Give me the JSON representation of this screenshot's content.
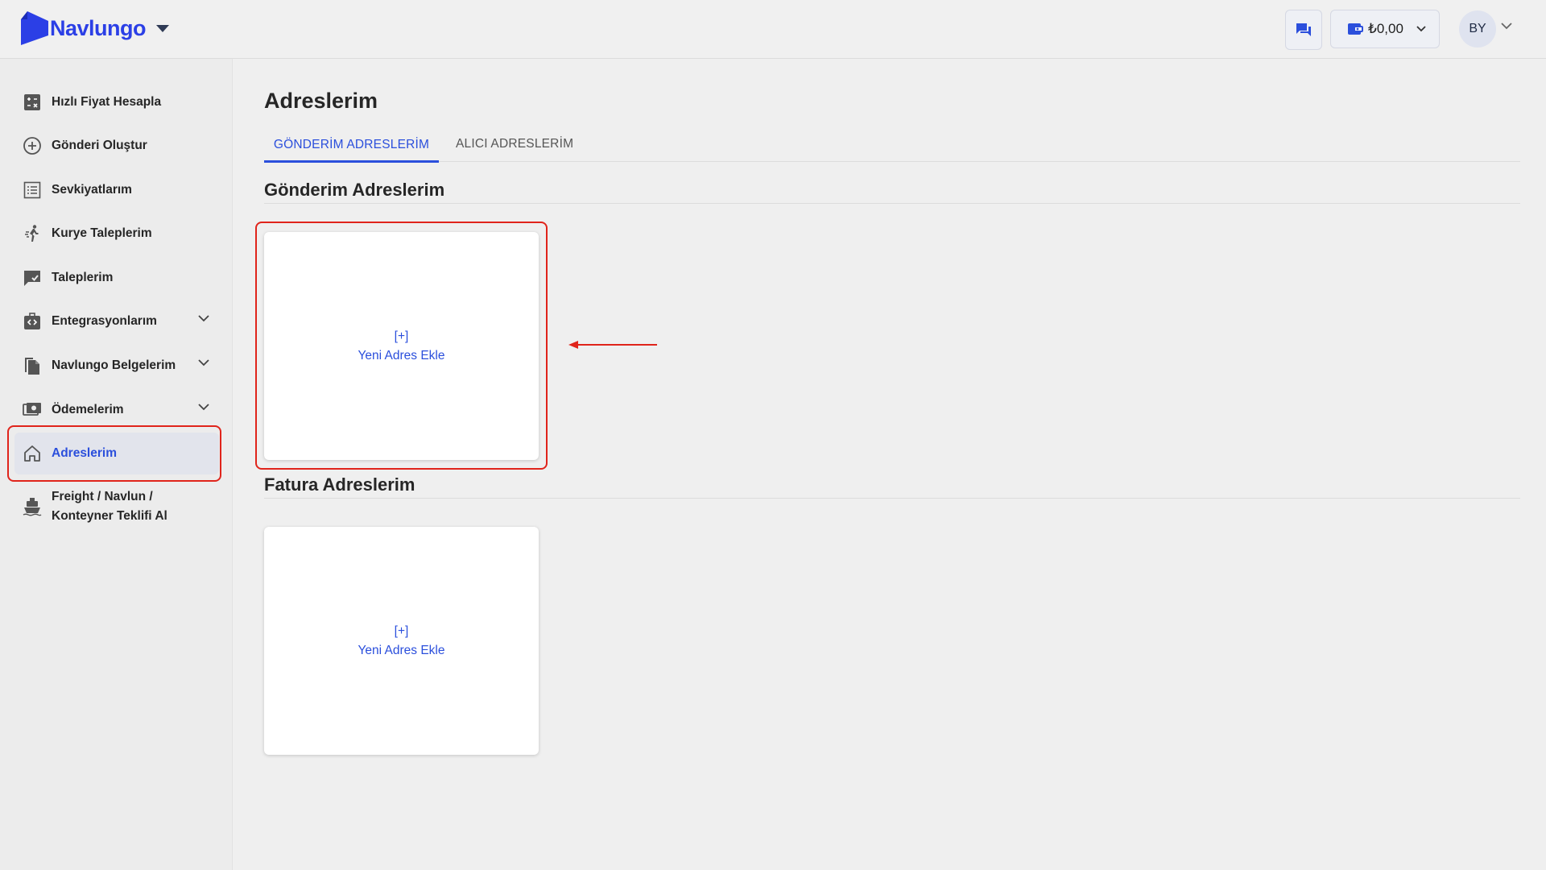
{
  "brand": {
    "name": "Navlungo",
    "color": "#2b3fe6"
  },
  "header": {
    "wallet_amount": "₺0,00",
    "avatar_initials": "BY"
  },
  "sidebar": {
    "items": [
      {
        "label": "Hızlı Fiyat Hesapla",
        "icon": "calculator-icon"
      },
      {
        "label": "Gönderi Oluştur",
        "icon": "plus-circle-icon"
      },
      {
        "label": "Sevkiyatlarım",
        "icon": "list-icon"
      },
      {
        "label": "Kurye Taleplerim",
        "icon": "courier-icon"
      },
      {
        "label": "Taleplerim",
        "icon": "request-icon"
      },
      {
        "label": "Entegrasyonlarım",
        "icon": "integration-icon",
        "expandable": true
      },
      {
        "label": "Navlungo Belgelerim",
        "icon": "documents-icon",
        "expandable": true
      },
      {
        "label": "Ödemelerim",
        "icon": "payments-icon",
        "expandable": true
      },
      {
        "label": "Adreslerim",
        "icon": "home-icon",
        "active": true
      },
      {
        "label": "Freight / Navlun / Konteyner Teklifi Al",
        "label_line1": "Freight / Navlun /",
        "label_line2": "Konteyner Teklifi Al",
        "icon": "ship-icon"
      }
    ]
  },
  "main": {
    "title": "Adreslerim",
    "tabs": [
      {
        "label": "GÖNDERİM ADRESLERİM",
        "active": true
      },
      {
        "label": "ALICI ADRESLERİM",
        "active": false
      }
    ],
    "sections": [
      {
        "title": "Gönderim Adreslerim",
        "add_plus": "[+]",
        "add_label": "Yeni Adres Ekle"
      },
      {
        "title": "Fatura Adreslerim",
        "add_plus": "[+]",
        "add_label": "Yeni Adres Ekle"
      }
    ]
  },
  "colors": {
    "accent": "#2b4fdc",
    "highlight": "#e0241b"
  }
}
